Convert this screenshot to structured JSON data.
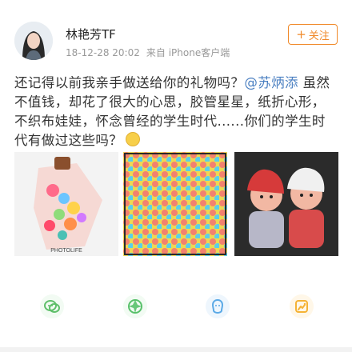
{
  "post": {
    "username": "林艳芳TF",
    "timestamp": "18-12-28 20:02",
    "source": "来自 iPhone客户端",
    "follow_label": "关注",
    "text_before": "还记得以前我亲手做送给你的礼物吗？",
    "mention": "@苏炳添",
    "text_after": " 虽然不值钱，却花了很大的心思，胶管星星，纸折心形，不织布娃娃，怀念曾经的学生时代......你们的学生时代有做过这些吗？",
    "images": [
      {
        "caption": "PHOTOLIFE"
      },
      {
        "caption": ""
      },
      {
        "caption": ""
      }
    ]
  },
  "share": {
    "icons": [
      "wechat-icon",
      "moments-icon",
      "qq-icon",
      "qzone-icon"
    ]
  },
  "colors": {
    "accent": "#f08a2a",
    "mention": "#4a7fc1",
    "share_wechat": "#5fbf6a",
    "share_moments": "#59c16b",
    "share_qq": "#5aa9e6",
    "share_qzone": "#f5b335"
  }
}
